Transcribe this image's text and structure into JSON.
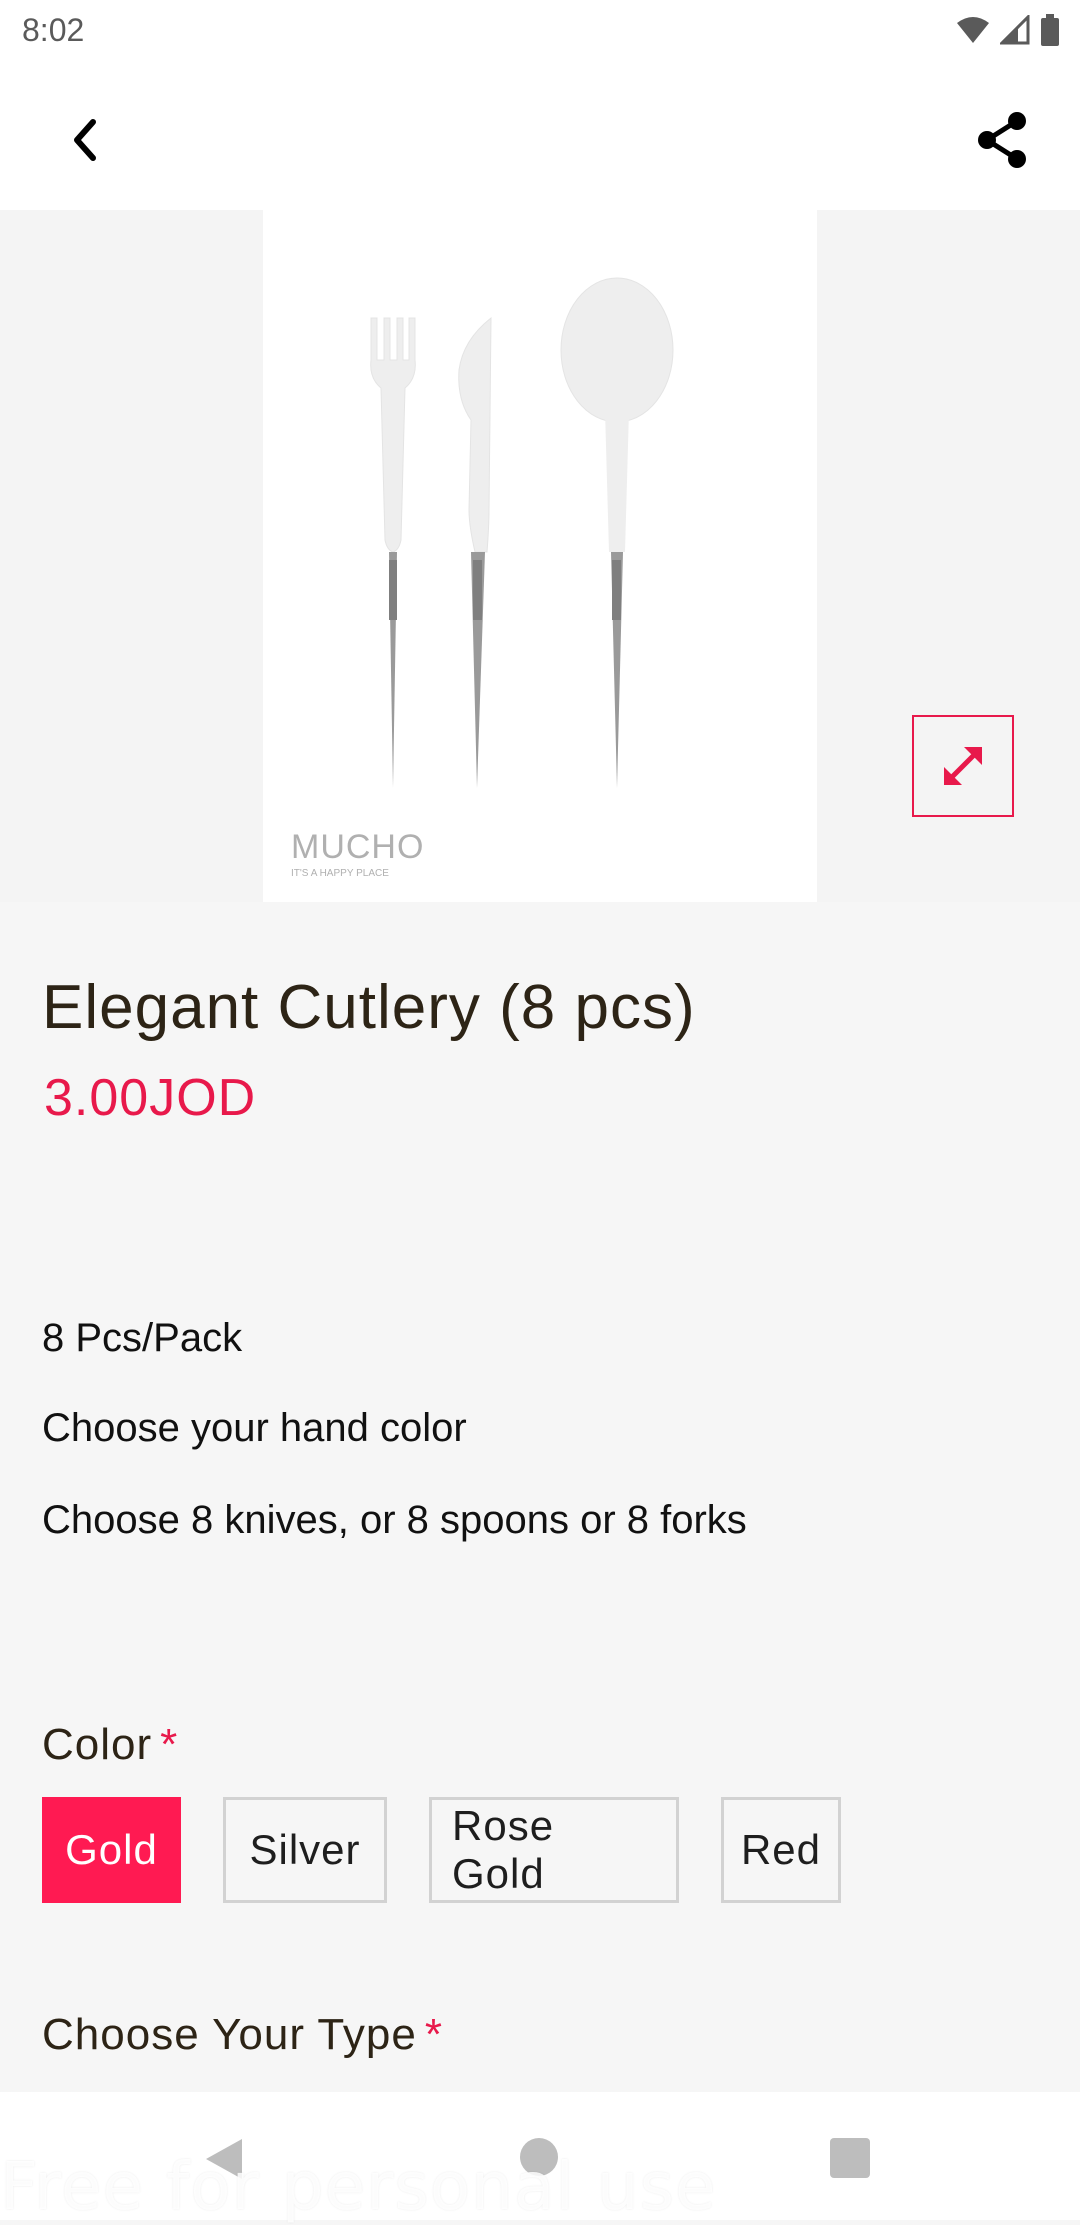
{
  "status_bar": {
    "time": "8:02"
  },
  "header": {
    "back_icon": "chevron-left-icon",
    "share_icon": "share-icon"
  },
  "product": {
    "image_alt": "White cutlery with silver handles: fork, knife, spoon",
    "brand_logo": "MUCHO",
    "brand_tagline": "IT'S A HAPPY PLACE",
    "title": "Elegant Cutlery (8 pcs)",
    "price": "3.00JOD",
    "description": [
      "8 Pcs/Pack",
      "Choose your hand color",
      "Choose 8 knives, or 8 spoons or 8 forks"
    ]
  },
  "options": {
    "color": {
      "label": "Color",
      "required_mark": "*",
      "choices": [
        "Gold",
        "Silver",
        "Rose Gold",
        "Red"
      ],
      "selected": "Gold"
    },
    "type": {
      "label": "Choose Your Type",
      "required_mark": "*"
    }
  },
  "watermark": "Free for personal use",
  "colors": {
    "accent": "#e8194b",
    "selected_chip": "#ff1a52",
    "title": "#2d2416"
  }
}
